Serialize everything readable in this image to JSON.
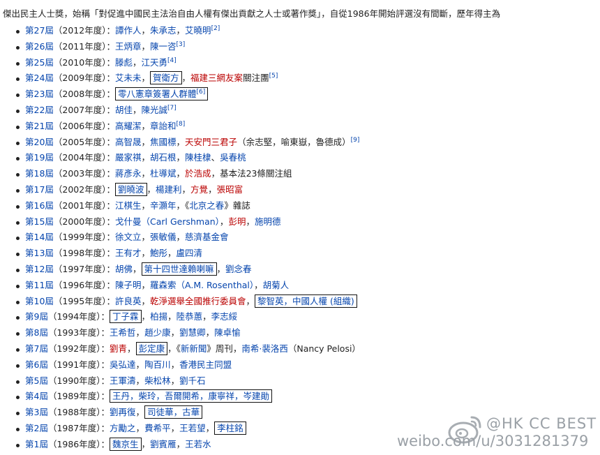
{
  "intro": "傑出民主人士獎，始稱「對促進中國民主法治自由人權有傑出貢獻之人士或著作獎」，自從1986年開始評選沒有間斷，歷年得主為",
  "rows": [
    {
      "ed": "第27屆",
      "yr": "（2012年度）",
      "parts": [
        {
          "t": "譚作人",
          "c": "link"
        },
        {
          "t": "，",
          "c": "plain"
        },
        {
          "t": "朱承志",
          "c": "link"
        },
        {
          "t": "，",
          "c": "plain"
        },
        {
          "t": "艾曉明",
          "c": "link"
        },
        {
          "t": "[2]",
          "c": "sup"
        }
      ]
    },
    {
      "ed": "第26屆",
      "yr": "（2011年度）",
      "parts": [
        {
          "t": "王炳章",
          "c": "link"
        },
        {
          "t": "，",
          "c": "plain"
        },
        {
          "t": "陳一咨",
          "c": "link"
        },
        {
          "t": "[3]",
          "c": "sup"
        }
      ]
    },
    {
      "ed": "第25屆",
      "yr": "（2010年度）",
      "parts": [
        {
          "t": "滕彪",
          "c": "link"
        },
        {
          "t": "，",
          "c": "plain"
        },
        {
          "t": "江天勇",
          "c": "link"
        },
        {
          "t": "[4]",
          "c": "sup"
        }
      ]
    },
    {
      "ed": "第24屆",
      "yr": "（2009年度）",
      "parts": [
        {
          "t": "艾未未",
          "c": "link"
        },
        {
          "t": "，",
          "c": "plain"
        },
        {
          "t": "賀衛方",
          "c": "link",
          "box": true
        },
        {
          "t": "，",
          "c": "plain"
        },
        {
          "t": "福建三網友案",
          "c": "red"
        },
        {
          "t": "關注團",
          "c": "plain"
        },
        {
          "t": "[5]",
          "c": "sup"
        }
      ]
    },
    {
      "ed": "第23屆",
      "yr": "（2008年度）",
      "parts": [
        {
          "t": "零八憲章簽署人群體",
          "c": "link",
          "box": true,
          "sup": "[6]"
        }
      ]
    },
    {
      "ed": "第22屆",
      "yr": "（2007年度）",
      "parts": [
        {
          "t": "胡佳",
          "c": "link"
        },
        {
          "t": "，",
          "c": "plain"
        },
        {
          "t": "陳光誠",
          "c": "link"
        },
        {
          "t": "[7]",
          "c": "sup"
        }
      ]
    },
    {
      "ed": "第21屆",
      "yr": "（2006年度）",
      "parts": [
        {
          "t": "高耀潔",
          "c": "link"
        },
        {
          "t": "，",
          "c": "plain"
        },
        {
          "t": "章詒和",
          "c": "link"
        },
        {
          "t": "[8]",
          "c": "sup"
        }
      ]
    },
    {
      "ed": "第20屆",
      "yr": "（2005年度）",
      "parts": [
        {
          "t": "高智晟",
          "c": "link"
        },
        {
          "t": "，",
          "c": "plain"
        },
        {
          "t": "焦國標",
          "c": "link"
        },
        {
          "t": "，",
          "c": "plain"
        },
        {
          "t": "天安門三君子",
          "c": "red"
        },
        {
          "t": "（余志堅，喻東嶽，魯德成）",
          "c": "plain"
        },
        {
          "t": "[9]",
          "c": "sup"
        }
      ]
    },
    {
      "ed": "第19屆",
      "yr": "（2004年度）",
      "parts": [
        {
          "t": "嚴家祺",
          "c": "link"
        },
        {
          "t": "，",
          "c": "plain"
        },
        {
          "t": "胡石根",
          "c": "link"
        },
        {
          "t": "，",
          "c": "plain"
        },
        {
          "t": "陳桂棣",
          "c": "link"
        },
        {
          "t": "、",
          "c": "plain"
        },
        {
          "t": "吳春桃",
          "c": "link"
        }
      ]
    },
    {
      "ed": "第18屆",
      "yr": "（2003年度）",
      "parts": [
        {
          "t": "蔣彥永",
          "c": "link"
        },
        {
          "t": "，",
          "c": "plain"
        },
        {
          "t": "杜導斌",
          "c": "link"
        },
        {
          "t": "，",
          "c": "plain"
        },
        {
          "t": "於浩成",
          "c": "red"
        },
        {
          "t": "，基本法23條關注組",
          "c": "plain"
        }
      ]
    },
    {
      "ed": "第17屆",
      "yr": "（2002年度）",
      "parts": [
        {
          "t": "劉曉波",
          "c": "link",
          "box": true
        },
        {
          "t": "，",
          "c": "plain"
        },
        {
          "t": "楊建利",
          "c": "link"
        },
        {
          "t": "，",
          "c": "plain"
        },
        {
          "t": "方覺",
          "c": "red"
        },
        {
          "t": "，",
          "c": "plain"
        },
        {
          "t": "張昭富",
          "c": "red"
        }
      ]
    },
    {
      "ed": "第16屆",
      "yr": "（2001年度）",
      "parts": [
        {
          "t": "江棋生",
          "c": "link"
        },
        {
          "t": "，",
          "c": "plain"
        },
        {
          "t": "辛灝年",
          "c": "link"
        },
        {
          "t": "，《",
          "c": "plain"
        },
        {
          "t": "北京之春",
          "c": "link"
        },
        {
          "t": "》雜誌",
          "c": "plain"
        }
      ]
    },
    {
      "ed": "第15屆",
      "yr": "（2000年度）",
      "parts": [
        {
          "t": "戈什曼（Carl Gershman）",
          "c": "link"
        },
        {
          "t": "，",
          "c": "plain"
        },
        {
          "t": "彭明",
          "c": "red"
        },
        {
          "t": "，",
          "c": "plain"
        },
        {
          "t": "施明德",
          "c": "link"
        }
      ]
    },
    {
      "ed": "第14屆",
      "yr": "（1999年度）",
      "parts": [
        {
          "t": "徐文立",
          "c": "link"
        },
        {
          "t": "，",
          "c": "plain"
        },
        {
          "t": "張敏儀",
          "c": "link"
        },
        {
          "t": "，",
          "c": "plain"
        },
        {
          "t": "慈濟基金會",
          "c": "link"
        }
      ]
    },
    {
      "ed": "第13屆",
      "yr": "（1998年度）",
      "parts": [
        {
          "t": "王有才",
          "c": "link"
        },
        {
          "t": "，",
          "c": "plain"
        },
        {
          "t": "鮑彤",
          "c": "link"
        },
        {
          "t": "，",
          "c": "plain"
        },
        {
          "t": "盧四清",
          "c": "link"
        }
      ]
    },
    {
      "ed": "第12屆",
      "yr": "（1997年度）",
      "parts": [
        {
          "t": "胡佛",
          "c": "link"
        },
        {
          "t": "，",
          "c": "plain"
        },
        {
          "t": "第十四世達賴喇嘛",
          "c": "link",
          "box": true
        },
        {
          "t": "，",
          "c": "plain"
        },
        {
          "t": "劉念春",
          "c": "link"
        }
      ]
    },
    {
      "ed": "第11屆",
      "yr": "（1996年度）",
      "parts": [
        {
          "t": "陳子明",
          "c": "link"
        },
        {
          "t": "，",
          "c": "plain"
        },
        {
          "t": "羅森索（A.M. Rosenthal）",
          "c": "link"
        },
        {
          "t": "，",
          "c": "plain"
        },
        {
          "t": "胡菊人",
          "c": "link"
        }
      ]
    },
    {
      "ed": "第10屆",
      "yr": "（1995年度）",
      "parts": [
        {
          "t": "許良英",
          "c": "link"
        },
        {
          "t": "，",
          "c": "plain"
        },
        {
          "t": "乾淨選舉全國推行委員會",
          "c": "red"
        },
        {
          "t": "，",
          "c": "plain"
        },
        {
          "t": "黎智英，中國人權 (組織)",
          "c": "link",
          "box": true
        }
      ]
    },
    {
      "ed": "第9屆",
      "yr": "（1994年度）",
      "parts": [
        {
          "t": "丁子霖",
          "c": "link",
          "box": true
        },
        {
          "t": "，",
          "c": "plain"
        },
        {
          "t": "柏揚",
          "c": "link"
        },
        {
          "t": "，",
          "c": "plain"
        },
        {
          "t": "陸恭蕙",
          "c": "link"
        },
        {
          "t": "，",
          "c": "plain"
        },
        {
          "t": "李志綏",
          "c": "link"
        }
      ]
    },
    {
      "ed": "第8屆",
      "yr": "（1993年度）",
      "parts": [
        {
          "t": "王希哲",
          "c": "link"
        },
        {
          "t": "，",
          "c": "plain"
        },
        {
          "t": "趙少康",
          "c": "link"
        },
        {
          "t": "，",
          "c": "plain"
        },
        {
          "t": "劉慧卿",
          "c": "link"
        },
        {
          "t": "，",
          "c": "plain"
        },
        {
          "t": "陳卓愉",
          "c": "link"
        }
      ]
    },
    {
      "ed": "第7屆",
      "yr": "（1992年度）",
      "parts": [
        {
          "t": "劉青",
          "c": "red"
        },
        {
          "t": "，",
          "c": "plain"
        },
        {
          "t": "彭定康",
          "c": "link",
          "box": true
        },
        {
          "t": "，《",
          "c": "plain"
        },
        {
          "t": "新新聞",
          "c": "link"
        },
        {
          "t": "》周刊，",
          "c": "plain"
        },
        {
          "t": "南希·裴洛西",
          "c": "link"
        },
        {
          "t": "（Nancy Pelosi）",
          "c": "plain"
        }
      ]
    },
    {
      "ed": "第6屆",
      "yr": "（1991年度）",
      "parts": [
        {
          "t": "吳弘達",
          "c": "link"
        },
        {
          "t": "，",
          "c": "plain"
        },
        {
          "t": "陶百川",
          "c": "link"
        },
        {
          "t": "，",
          "c": "plain"
        },
        {
          "t": "香港民主同盟",
          "c": "link"
        }
      ]
    },
    {
      "ed": "第5屆",
      "yr": "（1990年度）",
      "parts": [
        {
          "t": "王軍濤",
          "c": "link"
        },
        {
          "t": "，",
          "c": "plain"
        },
        {
          "t": "柴松林",
          "c": "link"
        },
        {
          "t": "，",
          "c": "plain"
        },
        {
          "t": "劉千石",
          "c": "link"
        }
      ]
    },
    {
      "ed": "第4屆",
      "yr": "（1989年度）",
      "parts": [
        {
          "t": "王丹，柴玲，吾爾開希，康寧祥，岑建勛",
          "c": "link",
          "box": true
        }
      ]
    },
    {
      "ed": "第3屆",
      "yr": "（1988年度）",
      "parts": [
        {
          "t": "劉再復",
          "c": "link"
        },
        {
          "t": "，",
          "c": "plain"
        },
        {
          "t": "司徒華，古華",
          "c": "link",
          "box": true
        }
      ]
    },
    {
      "ed": "第2屆",
      "yr": "（1987年度）",
      "parts": [
        {
          "t": "方勵之",
          "c": "link"
        },
        {
          "t": "，",
          "c": "plain"
        },
        {
          "t": "費希平",
          "c": "link"
        },
        {
          "t": "，",
          "c": "plain"
        },
        {
          "t": "王若望",
          "c": "link"
        },
        {
          "t": "，",
          "c": "plain"
        },
        {
          "t": "李柱銘",
          "c": "link",
          "box": true
        }
      ]
    },
    {
      "ed": "第1屆",
      "yr": "（1986年度）",
      "parts": [
        {
          "t": "魏京生",
          "c": "link",
          "box": true
        },
        {
          "t": "，",
          "c": "plain"
        },
        {
          "t": "劉賓雁",
          "c": "link"
        },
        {
          "t": "，",
          "c": "plain"
        },
        {
          "t": "王若水",
          "c": "link"
        }
      ]
    }
  ],
  "watermark": {
    "handle": "@HK CC BEST",
    "url": "weibo.com/u/3031281379",
    "icon": "weibo-logo-icon",
    "color": "#9aa0a6"
  }
}
